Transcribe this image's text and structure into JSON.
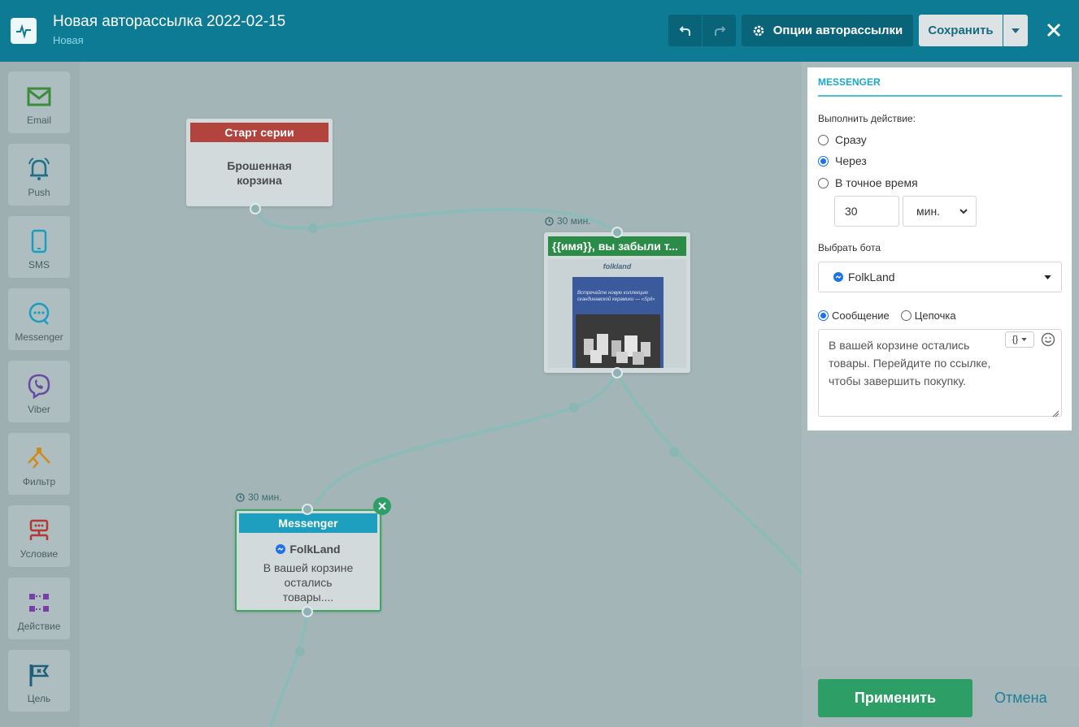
{
  "header": {
    "title": "Новая авторассылка 2022-02-15",
    "subtitle": "Новая",
    "options_label": "Опции авторассылки",
    "save_label": "Сохранить"
  },
  "sidebar": {
    "items": [
      {
        "label": "Email",
        "icon": "mail-icon"
      },
      {
        "label": "Push",
        "icon": "bell-icon"
      },
      {
        "label": "SMS",
        "icon": "phone-icon"
      },
      {
        "label": "Messenger",
        "icon": "chat-icon"
      },
      {
        "label": "Viber",
        "icon": "viber-icon"
      },
      {
        "label": "Фильтр",
        "icon": "filter-icon"
      },
      {
        "label": "Условие",
        "icon": "condition-icon"
      },
      {
        "label": "Действие",
        "icon": "action-icon"
      },
      {
        "label": "Цель",
        "icon": "flag-icon"
      }
    ]
  },
  "canvas": {
    "start_node": {
      "header": "Старт серии",
      "body": "Брошенная корзина"
    },
    "email_node": {
      "timer": "30 мин.",
      "header": "{{имя}}, вы забыли т...",
      "brand": "folkland",
      "preview_text": "Встречайте новую коллекцию скандинавской керамики — «Spil»"
    },
    "messenger_node": {
      "timer": "30 мин.",
      "header": "Messenger",
      "bot": "FolkLand",
      "text": "В вашей корзине остались товары...."
    }
  },
  "panel": {
    "title": "MESSENGER",
    "action_label": "Выполнить действие:",
    "timing_options": [
      "Сразу",
      "Через",
      "В точное время"
    ],
    "timing_selected": "Через",
    "delay_value": "30",
    "delay_unit": "мин.",
    "bot_label": "Выбрать бота",
    "bot_value": "FolkLand",
    "message_types": [
      "Сообщение",
      "Цепочка"
    ],
    "message_type_selected": "Сообщение",
    "message_text": "В вашей корзине остались товары. Перейдите по ссылке, чтобы завершить покупку.",
    "vars_button": "{}"
  },
  "footer": {
    "apply_label": "Применить",
    "cancel_label": "Отмена"
  },
  "colors": {
    "header": "#0c7b93",
    "start": "#b2443d",
    "email": "#2a8c46",
    "messenger": "#1f9fbf",
    "apply": "#2e9e67"
  }
}
